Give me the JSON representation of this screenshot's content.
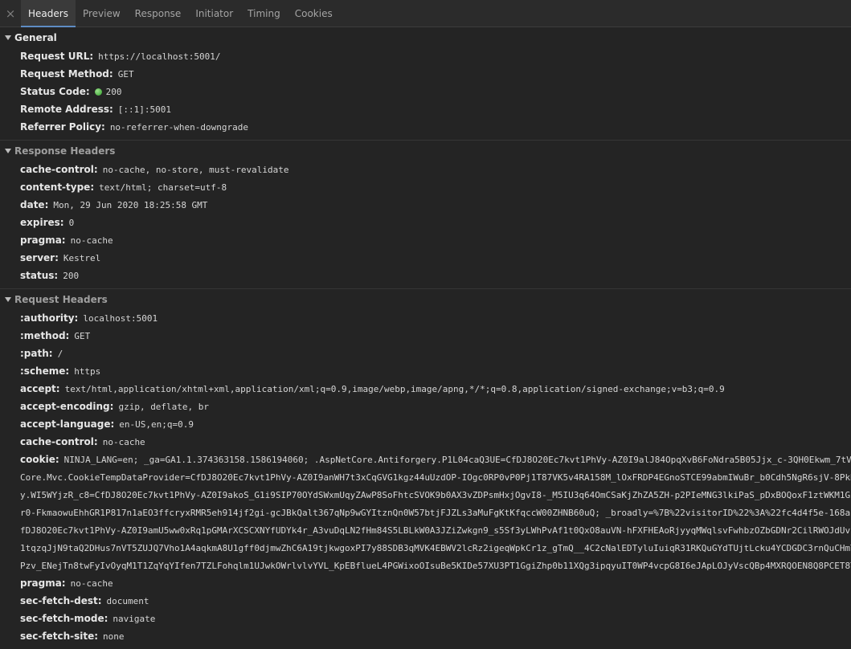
{
  "tabs": {
    "close_glyph": "×",
    "items": [
      "Headers",
      "Preview",
      "Response",
      "Initiator",
      "Timing",
      "Cookies"
    ],
    "active": "Headers"
  },
  "general": {
    "title": "General",
    "rows": [
      {
        "key": "Request URL:",
        "value": "https://localhost:5001/"
      },
      {
        "key": "Request Method:",
        "value": "GET"
      },
      {
        "key": "Status Code:",
        "value": "200"
      },
      {
        "key": "Remote Address:",
        "value": "[::1]:5001"
      },
      {
        "key": "Referrer Policy:",
        "value": "no-referrer-when-downgrade"
      }
    ],
    "status_color": "#3cb530"
  },
  "response": {
    "title": "Response Headers",
    "rows": [
      {
        "key": "cache-control:",
        "value": "no-cache, no-store, must-revalidate"
      },
      {
        "key": "content-type:",
        "value": "text/html; charset=utf-8"
      },
      {
        "key": "date:",
        "value": "Mon, 29 Jun 2020 18:25:58 GMT"
      },
      {
        "key": "expires:",
        "value": "0"
      },
      {
        "key": "pragma:",
        "value": "no-cache"
      },
      {
        "key": "server:",
        "value": "Kestrel"
      },
      {
        "key": "status:",
        "value": "200"
      }
    ]
  },
  "request": {
    "title": "Request Headers",
    "rows": [
      {
        "key": ":authority:",
        "value": "localhost:5001"
      },
      {
        "key": ":method:",
        "value": "GET"
      },
      {
        "key": ":path:",
        "value": "/"
      },
      {
        "key": ":scheme:",
        "value": "https"
      },
      {
        "key": "accept:",
        "value": "text/html,application/xhtml+xml,application/xml;q=0.9,image/webp,image/apng,*/*;q=0.8,application/signed-exchange;v=b3;q=0.9"
      },
      {
        "key": "accept-encoding:",
        "value": "gzip, deflate, br"
      },
      {
        "key": "accept-language:",
        "value": "en-US,en;q=0.9"
      },
      {
        "key": "cache-control:",
        "value": "no-cache"
      }
    ],
    "cookie": {
      "key": "cookie:",
      "first": "NINJA_LANG=en; _ga=GA1.1.374363158.1586194060; .AspNetCore.Antiforgery.P1L04caQ3UE=CfDJ8O20Ec7kvt1PhVy-AZ0I9alJ84OpqXvB6FoNdra5B05Jjx_c-3QH0Ekwm_7tVmr",
      "lines": [
        "Core.Mvc.CookieTempDataProvider=CfDJ8O20Ec7kvt1PhVy-AZ0I9anWH7t3xCqGVG1kgz44uUzdOP-IOgc0RP0vP0Pj1T87VK5v4RA158M_lOxFRDP4EGnoSTCE99abmIWuBr_b0Cdh5NgR6sjV-8PkD",
        "y.WI5WYjzR_c8=CfDJ8O20Ec7kvt1PhVy-AZ0I9akoS_G1i9SIP70OYdSWxmUqyZAwP8SoFhtcSVOK9b0AX3vZDPsmHxjOgvI8-_M5IU3q64OmCSaKjZhZA5ZH-p2PIeMNG3lkiPaS_pDxBOQoxF1ztWKM1G2",
        "r0-FkmaowuEhhGR1P817n1aEO3ffcryxRMR5eh914jf2gi-gcJBkQalt367qNp9wGYItznQn0W57btjFJZLs3aMuFgKtKfqccW00ZHNB60uQ; _broadly=%7B%22visitorID%22%3A%22fc4d4f5e-168a-",
        "fDJ8O20Ec7kvt1PhVy-AZ0I9amU5ww0xRq1pGMArXCSCXNYfUDYk4r_A3vuDqLN2fHm84S5LBLkW0A3JZiZwkgn9_s5Sf3yLWhPvAf1t0QxO8auVN-hFXFHEAoRjyyqMWqlsvFwhbzOZbGDNr2CilRWOJdUvl",
        "1tqzqJjN9taQ2DHus7nVT5ZUJQ7Vho1A4aqkmA8U1gff0djmwZhC6A19tjkwgoxPI7y88SDB3qMVK4EBWV2lcRz2igeqWpkCr1z_gTmQ__4C2cNalEDTyluIuiqR31RKQuGYdTUjtLcku4YCDGDC3rnQuCHmT",
        "Pzv_ENejTn8twFyIvOyqM1T1ZqYqYIfen7TZLFohqlm1UJwkOWrlvlvYVL_KpEBflueL4PGWixoOIsuBe5KIDe57XU3PT1GgiZhp0b11XQg3ipqyuIT0WP4vcpG8I6eJApLOJyVscQBp4MXRQOEN8Q8PCET8T"
      ]
    },
    "rows_after": [
      {
        "key": "pragma:",
        "value": "no-cache"
      },
      {
        "key": "sec-fetch-dest:",
        "value": "document"
      },
      {
        "key": "sec-fetch-mode:",
        "value": "navigate"
      },
      {
        "key": "sec-fetch-site:",
        "value": "none"
      }
    ]
  }
}
